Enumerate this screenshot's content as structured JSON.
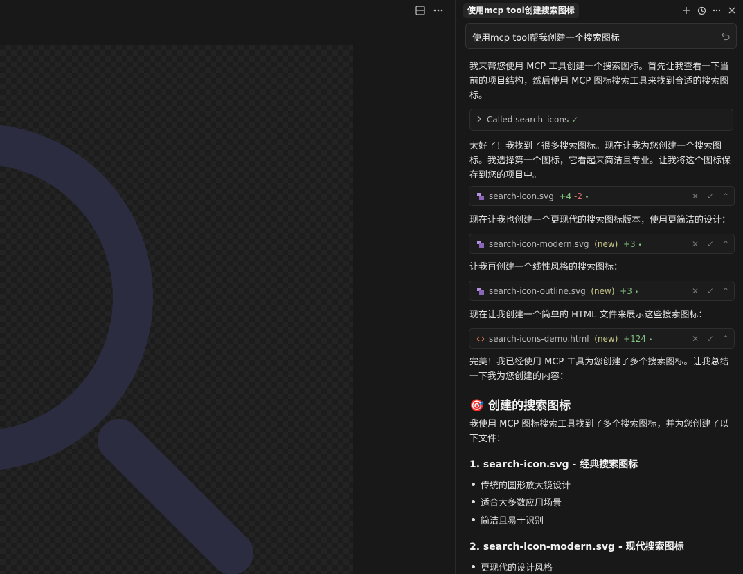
{
  "panel": {
    "tab_title": "使用mcp tool创建搜索图标",
    "prompt": "使用mcp tool帮我创建一个搜索图标",
    "messages": {
      "m1": "我来帮您使用 MCP 工具创建一个搜索图标。首先让我查看一下当前的项目结构，然后使用 MCP 图标搜索工具来找到合适的搜索图标。",
      "m2": "太好了！我找到了很多搜索图标。现在让我为您创建一个搜索图标。我选择第一个图标，它看起来简洁且专业。让我将这个图标保存到您的项目中。",
      "m3": "现在让我也创建一个更现代的搜索图标版本，使用更简洁的设计：",
      "m4": "让我再创建一个线性风格的搜索图标：",
      "m5": "现在让我创建一个简单的 HTML 文件来展示这些搜索图标：",
      "m6": "完美！我已经使用 MCP 工具为您创建了多个搜索图标。让我总结一下我为您创建的内容：",
      "m7": "我使用 MCP 图标搜索工具找到了多个搜索图标，并为您创建了以下文件："
    },
    "tool_call": {
      "label": "Called search_icons",
      "check": "✓"
    },
    "files": [
      {
        "name": "search-icon.svg",
        "new": "",
        "added": "+4",
        "removed": "-2",
        "dot": "•",
        "icon": "svg-file-icon"
      },
      {
        "name": "search-icon-modern.svg",
        "new": "(new)",
        "added": "+3",
        "removed": "",
        "dot": "•",
        "icon": "svg-file-icon"
      },
      {
        "name": "search-icon-outline.svg",
        "new": "(new)",
        "added": "+3",
        "removed": "",
        "dot": "•",
        "icon": "svg-file-icon"
      },
      {
        "name": "search-icons-demo.html",
        "new": "(new)",
        "added": "+124",
        "removed": "",
        "dot": "•",
        "icon": "html-file-icon"
      }
    ],
    "summary_heading": "🎯 创建的搜索图标",
    "section1": {
      "title": "1. search-icon.svg - 经典搜索图标",
      "items": [
        "传统的圆形放大镜设计",
        "适合大多数应用场景",
        "简洁且易于识别"
      ]
    },
    "section2": {
      "title": "2. search-icon-modern.svg - 现代搜索图标",
      "items": [
        "更现代的设计风格"
      ]
    }
  },
  "colors": {
    "icon_preview": "#2c2c40",
    "svg_icon": "#b78fe0",
    "html_icon": "#e07b4a"
  }
}
